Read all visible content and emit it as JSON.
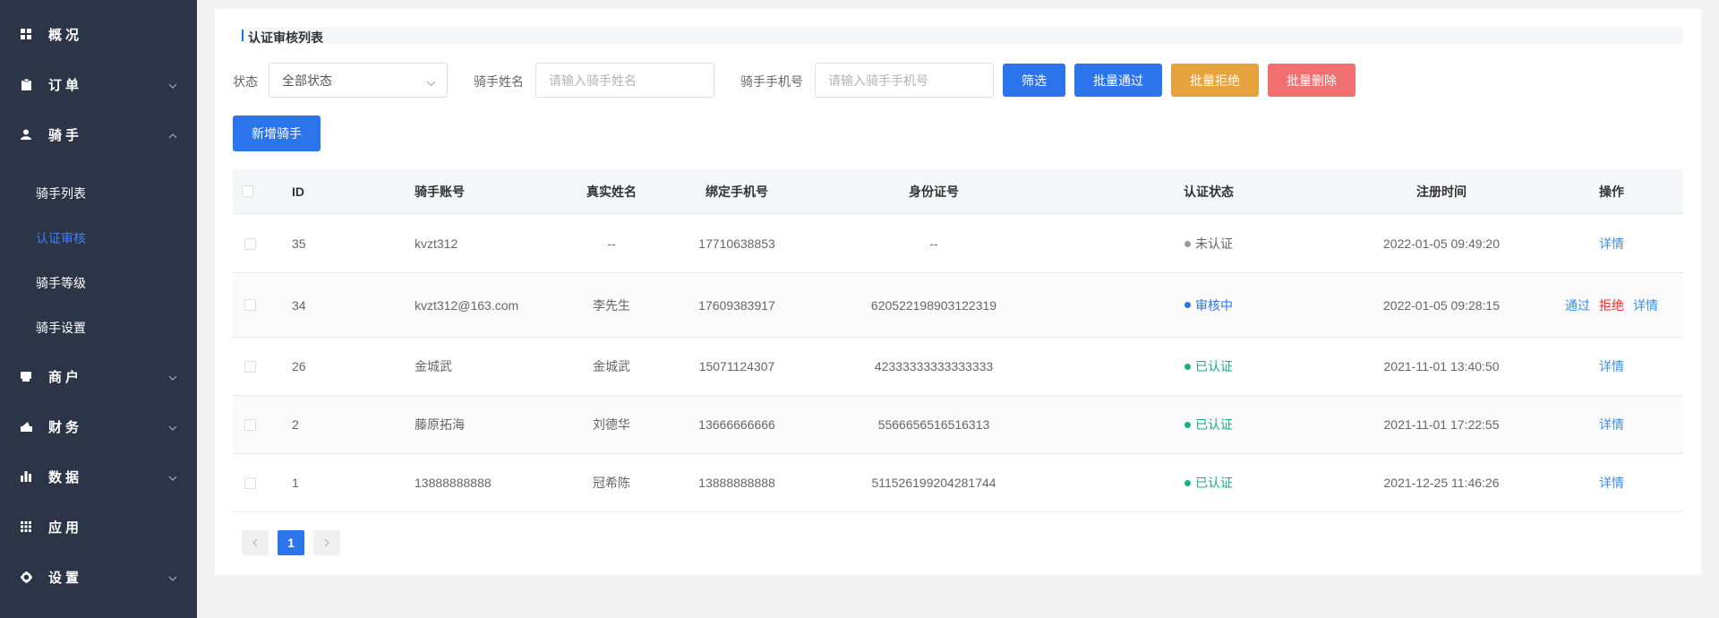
{
  "sidebar": {
    "items": [
      {
        "label": "概况",
        "icon": "grid-icon"
      },
      {
        "label": "订单",
        "icon": "clipboard-icon"
      },
      {
        "label": "骑手",
        "icon": "user-icon"
      },
      {
        "label": "商户",
        "icon": "store-icon"
      },
      {
        "label": "财务",
        "icon": "wallet-icon"
      },
      {
        "label": "数据",
        "icon": "bar-chart-icon"
      },
      {
        "label": "应用",
        "icon": "apps-icon"
      },
      {
        "label": "设置",
        "icon": "gear-icon"
      }
    ],
    "sub_items": [
      "骑手列表",
      "认证审核",
      "骑手等级",
      "骑手设置"
    ],
    "active_sub": "认证审核",
    "bg_color": "#2c3447",
    "active_color": "#3b82f6"
  },
  "page": {
    "title": "认证审核列表"
  },
  "filters": {
    "status_label": "状态",
    "status_value": "全部状态",
    "name_label": "骑手姓名",
    "name_placeholder": "请输入骑手姓名",
    "phone_label": "骑手手机号",
    "phone_placeholder": "请输入骑手手机号"
  },
  "buttons": {
    "filter": "筛选",
    "batch_approve": "批量通过",
    "batch_reject": "批量拒绝",
    "batch_delete": "批量删除",
    "add_rider": "新增骑手"
  },
  "colors": {
    "primary": "#2b74ec",
    "warning": "#e6a23c",
    "danger": "#f16f6f",
    "success": "#1aae88",
    "reject_text": "#ee2e2e",
    "link": "#3b8ee8",
    "unverified_dot": "#999999"
  },
  "table": {
    "columns": [
      "ID",
      "骑手账号",
      "真实姓名",
      "绑定手机号",
      "身份证号",
      "认证状态",
      "注册时间",
      "操作"
    ],
    "rows": [
      {
        "id": "35",
        "account": "kvzt312",
        "name": "--",
        "phone": "17710638853",
        "idcard": "--",
        "status": "未认证",
        "status_type": "gray",
        "time": "2022-01-05 09:49:20",
        "actions": [
          "详情"
        ]
      },
      {
        "id": "34",
        "account": "kvzt312@163.com",
        "name": "李先生",
        "phone": "17609383917",
        "idcard": "620522198903122319",
        "status": "审核中",
        "status_type": "blue",
        "time": "2022-01-05 09:28:15",
        "actions": [
          "通过",
          "拒绝",
          "详情"
        ]
      },
      {
        "id": "26",
        "account": "金城武",
        "name": "金城武",
        "phone": "15071124307",
        "idcard": "42333333333333333",
        "status": "已认证",
        "status_type": "green",
        "time": "2021-11-01 13:40:50",
        "actions": [
          "详情"
        ]
      },
      {
        "id": "2",
        "account": "藤原拓海",
        "name": "刘德华",
        "phone": "13666666666",
        "idcard": "5566656516516313",
        "status": "已认证",
        "status_type": "green",
        "time": "2021-11-01 17:22:55",
        "actions": [
          "详情"
        ]
      },
      {
        "id": "1",
        "account": "13888888888",
        "name": "冠希陈",
        "phone": "13888888888",
        "idcard": "511526199204281744",
        "status": "已认证",
        "status_type": "green",
        "time": "2021-12-25 11:46:26",
        "actions": [
          "详情"
        ]
      }
    ]
  },
  "pagination": {
    "current": "1",
    "prev_icon": "chevron-left-icon",
    "next_icon": "chevron-right-icon"
  }
}
